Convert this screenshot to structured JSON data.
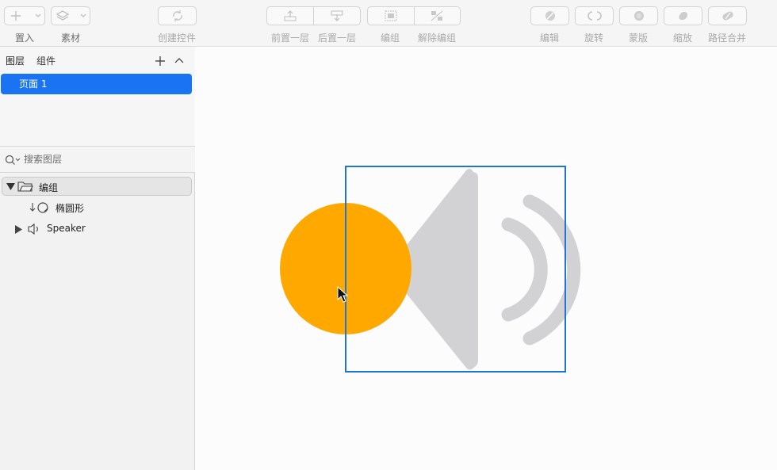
{
  "toolbar": {
    "insert_label": "置入",
    "assets_label": "素材",
    "create_component_label": "创建控件",
    "bring_forward_label": "前置一层",
    "send_backward_label": "后置一层",
    "group_label": "编组",
    "ungroup_label": "解除编组",
    "edit_label": "编辑",
    "rotate_label": "旋转",
    "mask_label": "蒙版",
    "scale_label": "缩放",
    "combine_label": "路径合并"
  },
  "sidebar": {
    "tab_layers": "图层",
    "tab_components": "组件",
    "pages": [
      {
        "label": "页面 1",
        "selected": true
      }
    ],
    "search_placeholder": "搜索图层",
    "layers": [
      {
        "name": "编组",
        "icon": "folder-icon",
        "expanded": true,
        "selected": true
      },
      {
        "name": "椭圆形",
        "icon": "ellipse-mask-icon",
        "child": true
      },
      {
        "name": "Speaker",
        "icon": "speaker-icon",
        "expanded": false
      }
    ]
  },
  "colors": {
    "accent": "#1a73f3",
    "ellipse_fill": "#ffa900",
    "speaker_fill": "#d2d1d4",
    "selection_border": "#1f76d2"
  }
}
